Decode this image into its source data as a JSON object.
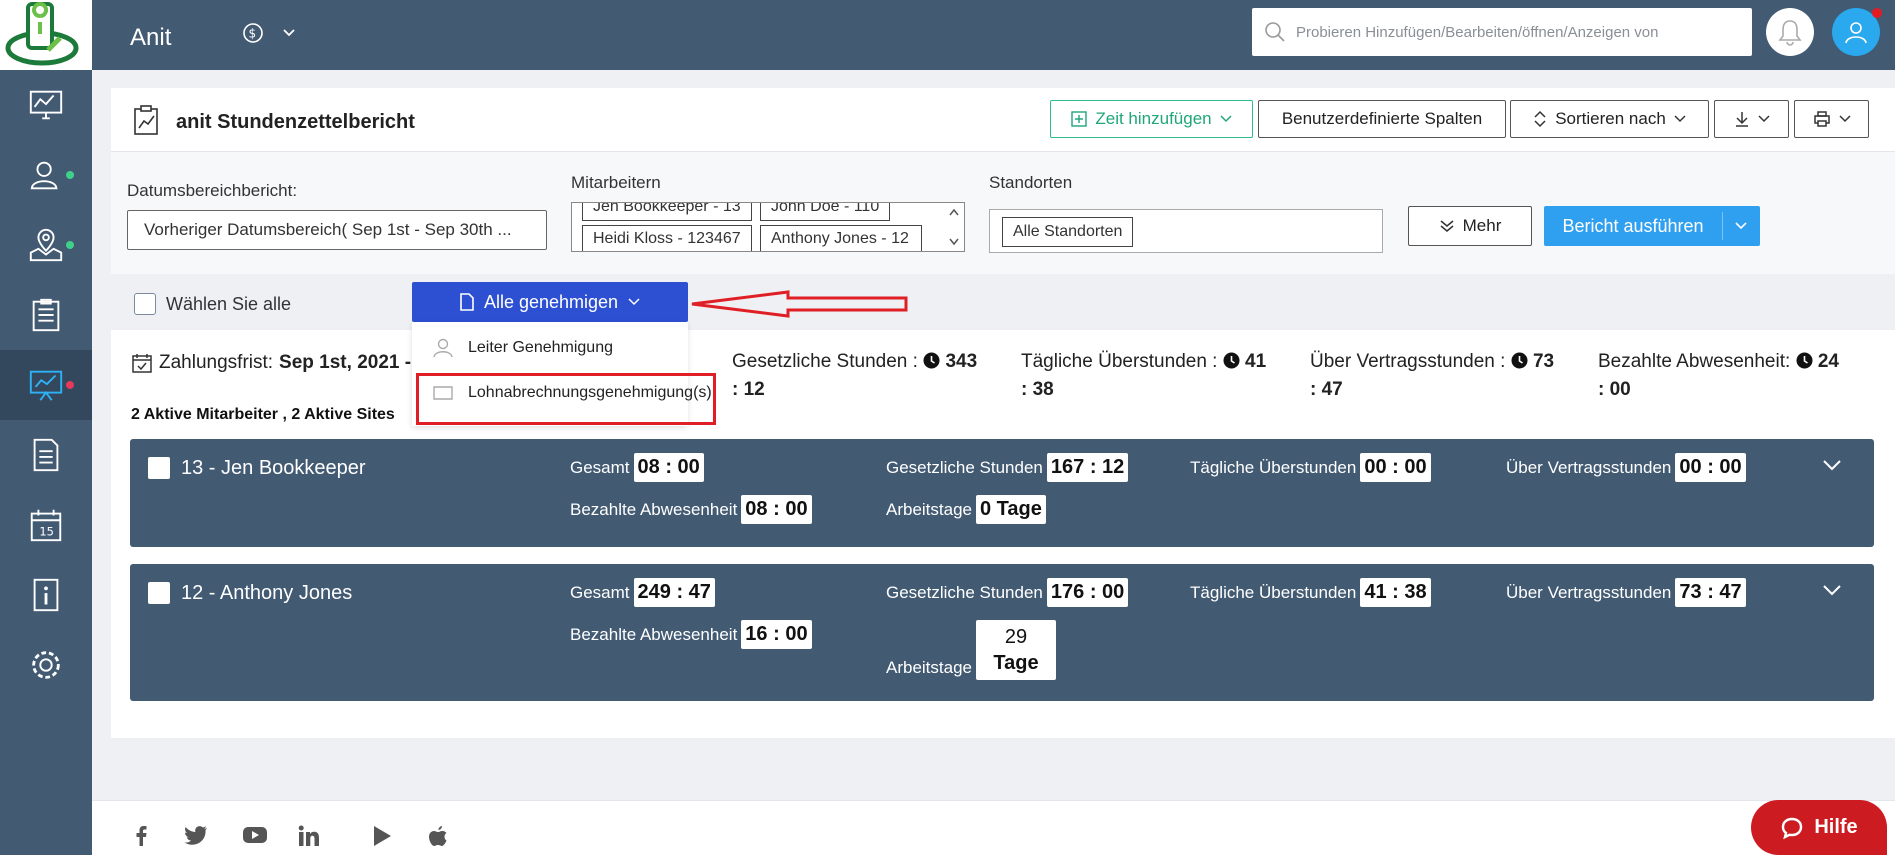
{
  "header": {
    "app_title": "Anit",
    "search_placeholder": "Probieren Hinzufügen/Bearbeiten/öffnen/Anzeigen von"
  },
  "report": {
    "title": "anit Stundenzettelbericht",
    "add_time": "Zeit hinzufügen",
    "custom_columns": "Benutzerdefinierte Spalten",
    "sort_by": "Sortieren nach"
  },
  "filters": {
    "date_label": "Datumsbereichbericht:",
    "date_value": "Vorheriger Datumsbereich( Sep 1st - Sep 30th ...",
    "employees_label": "Mitarbeitern",
    "employee_tags": [
      "Jen Bookkeeper - 13",
      "John Doe - 110",
      "Heidi Kloss - 123467",
      "Anthony Jones - 12"
    ],
    "locations_label": "Standorten",
    "location_tag": "Alle Standorten",
    "more": "Mehr",
    "run_report": "Bericht ausführen"
  },
  "select_all": "Wählen Sie alle",
  "approve": {
    "button": "Alle genehmigen",
    "items": [
      "Leiter Genehmigung",
      "Lohnabrechnungsgenehmigung(s)"
    ]
  },
  "summary": {
    "pay_label": "Zahlungsfrist:",
    "pay_value": "Sep 1st, 2021 -",
    "stats": [
      {
        "label": "Gesetzliche Stunden :",
        "v1": "343",
        "v2": ": 12"
      },
      {
        "label": "Tägliche Überstunden :",
        "v1": "41",
        "v2": ": 38"
      },
      {
        "label": "Über Vertragsstunden :",
        "v1": "73",
        "v2": ": 47"
      },
      {
        "label": "Bezahlte Abwesenheit:",
        "v1": "24",
        "v2": ": 00"
      }
    ],
    "active_line": "2 Aktive Mitarbeiter , 2 Aktive Sites"
  },
  "employees": [
    {
      "name": "13 - Jen Bookkeeper",
      "total_label": "Gesamt",
      "total": "08 : 00",
      "legal_label": "Gesetzliche Stunden",
      "legal": "167 : 12",
      "daily_label": "Tägliche Überstunden",
      "daily": "00 : 00",
      "contract_label": "Über Vertragsstunden",
      "contract": "00 : 00",
      "absence_label": "Bezahlte Abwesenheit",
      "absence": "08 : 00",
      "days_label": "Arbeitstage",
      "days": "0 Tage"
    },
    {
      "name": "12 - Anthony Jones",
      "total_label": "Gesamt",
      "total": "249 : 47",
      "legal_label": "Gesetzliche Stunden",
      "legal": "176 : 00",
      "daily_label": "Tägliche Überstunden",
      "daily": "41 : 38",
      "contract_label": "Über Vertragsstunden",
      "contract": "73 : 47",
      "absence_label": "Bezahlte Abwesenheit",
      "absence": "16 : 00",
      "days_label": "Arbeitstage",
      "days_num": "29",
      "days_unit": "Tage"
    }
  ],
  "help": "Hilfe",
  "colors": {
    "sidebar": "#435a73",
    "primary": "#2f9ff0",
    "approve": "#2d4fd1",
    "highlight": "#e01e26",
    "help": "#cc1b21"
  }
}
